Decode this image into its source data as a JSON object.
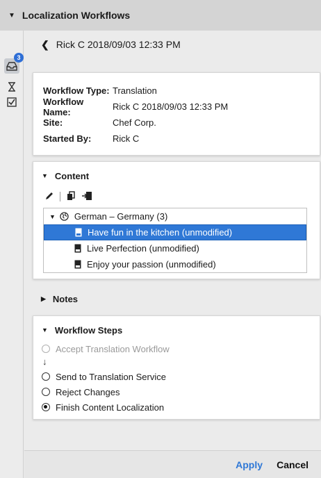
{
  "panel": {
    "title": "Localization Workflows",
    "collapse_icon": "caret-down-icon"
  },
  "rail": {
    "inbox_badge": "3",
    "icons": [
      "inbox-icon",
      "hourglass-icon",
      "checkbox-icon"
    ]
  },
  "header": {
    "back_title": "Rick C 2018/09/03 12:33 PM"
  },
  "info": {
    "rows": [
      {
        "key": "Workflow Type:",
        "value": "Translation"
      },
      {
        "key": "Workflow Name:",
        "value": "Rick C 2018/09/03 12:33 PM"
      },
      {
        "key": "Site:",
        "value": "Chef Corp."
      },
      {
        "key": "Started By:",
        "value": "Rick C"
      }
    ]
  },
  "content": {
    "heading": "Content",
    "toolbar_icons": [
      "pencil-icon",
      "copy-icon",
      "insert-icon"
    ],
    "tree": {
      "root": "German – Germany (3)",
      "items": [
        {
          "label": "Have fun in the kitchen (unmodified)",
          "selected": true
        },
        {
          "label": "Live Perfection (unmodified)",
          "selected": false
        },
        {
          "label": "Enjoy your passion (unmodified)",
          "selected": false
        }
      ]
    }
  },
  "notes": {
    "heading": "Notes"
  },
  "steps": {
    "heading": "Workflow Steps",
    "items": [
      {
        "label": "Accept Translation Workflow",
        "state": "disabled"
      },
      {
        "label": "Send to Translation Service",
        "state": "unselected"
      },
      {
        "label": "Reject Changes",
        "state": "unselected"
      },
      {
        "label": "Finish Content Localization",
        "state": "selected"
      }
    ],
    "arrow": "↓"
  },
  "footer": {
    "apply_label": "Apply",
    "cancel_label": "Cancel"
  },
  "colors": {
    "accent": "#2f78d6",
    "badge": "#2f6fd6"
  }
}
